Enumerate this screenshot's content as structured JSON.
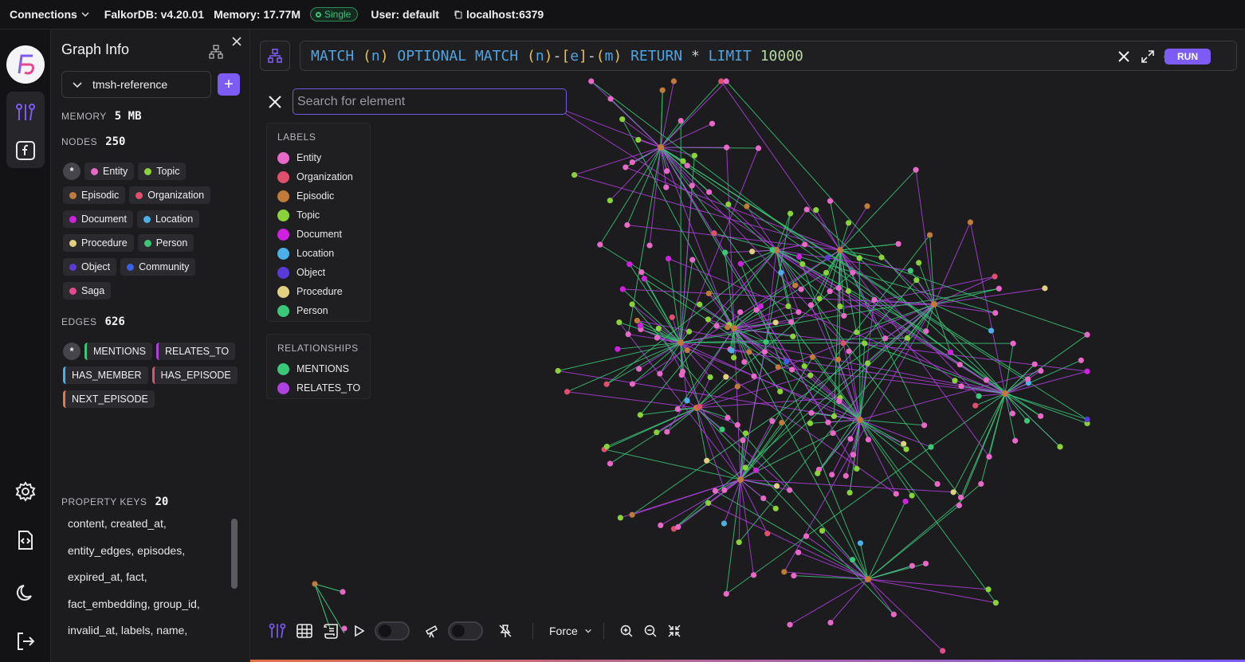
{
  "topbar": {
    "connections_label": "Connections",
    "version": "FalkorDB: v4.20.01",
    "memory": "Memory: 17.77M",
    "mode_badge": "Single",
    "user": "User: default",
    "host": "localhost:6379"
  },
  "panel": {
    "title": "Graph Info",
    "graph_name": "tmsh-reference",
    "memory_label": "MEMORY",
    "memory_value": "5 MB",
    "nodes_label": "NODES",
    "nodes_value": "250",
    "node_labels": [
      {
        "name": "Entity",
        "color": "#e868c8"
      },
      {
        "name": "Topic",
        "color": "#8ad23a"
      },
      {
        "name": "Episodic",
        "color": "#c07a3a"
      },
      {
        "name": "Organization",
        "color": "#e0506e"
      },
      {
        "name": "Document",
        "color": "#d020e0"
      },
      {
        "name": "Location",
        "color": "#4cb0e8"
      },
      {
        "name": "Procedure",
        "color": "#e2d080"
      },
      {
        "name": "Person",
        "color": "#3ac878"
      },
      {
        "name": "Object",
        "color": "#5a3ad8"
      },
      {
        "name": "Community",
        "color": "#3a60e8"
      },
      {
        "name": "Saga",
        "color": "#e84890"
      }
    ],
    "edges_label": "EDGES",
    "edges_value": "626",
    "edge_types": [
      {
        "name": "MENTIONS",
        "color": "#3ac878"
      },
      {
        "name": "RELATES_TO",
        "color": "#b040e0"
      },
      {
        "name": "HAS_MEMBER",
        "color": "#4cb0e8"
      },
      {
        "name": "HAS_EPISODE",
        "color": "#e0506e"
      },
      {
        "name": "NEXT_EPISODE",
        "color": "#e07a4a"
      }
    ],
    "property_keys_label": "PROPERTY KEYS",
    "property_keys_value": "20",
    "property_keys": [
      "content, created_at,",
      "entity_edges, episodes,",
      "expired_at, fact,",
      "fact_embedding, group_id,",
      "invalid_at, labels, name,"
    ]
  },
  "query": {
    "kw_match": "MATCH",
    "p_open": "(",
    "var_n": "n",
    "p_close": ")",
    "kw_optional": "OPTIONAL MATCH",
    "dash": "-",
    "b_open": "[",
    "var_e": "e",
    "b_close": "]",
    "var_m": "m",
    "kw_return": "RETURN",
    "star": "*",
    "kw_limit": "LIMIT",
    "limit_value": "10000",
    "run_label": "RUN"
  },
  "search": {
    "placeholder": "Search for element"
  },
  "legend": {
    "labels_title": "LABELS",
    "labels": [
      {
        "name": "Entity",
        "color": "#e868c8"
      },
      {
        "name": "Organization",
        "color": "#e0506e"
      },
      {
        "name": "Episodic",
        "color": "#c07a3a"
      },
      {
        "name": "Topic",
        "color": "#8ad23a"
      },
      {
        "name": "Document",
        "color": "#d020e0"
      },
      {
        "name": "Location",
        "color": "#4cb0e8"
      },
      {
        "name": "Object",
        "color": "#5a3ad8"
      },
      {
        "name": "Procedure",
        "color": "#e2d080"
      },
      {
        "name": "Person",
        "color": "#3ac878"
      }
    ],
    "relationships_title": "RELATIONSHIPS",
    "relationships": [
      {
        "name": "MENTIONS",
        "color": "#3ac878"
      },
      {
        "name": "RELATES_TO",
        "color": "#b040e0"
      }
    ]
  },
  "toolbar": {
    "layout_label": "Force"
  }
}
